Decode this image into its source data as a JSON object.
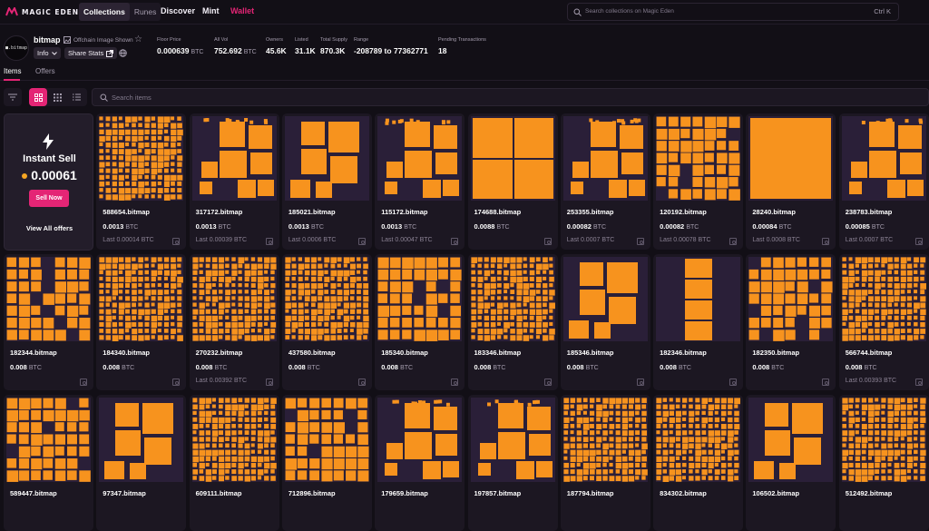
{
  "brand": {
    "name": "MAGIC EDEN",
    "accent": "#e42575"
  },
  "nav": {
    "tabs": [
      {
        "label": "Collections",
        "active": true
      },
      {
        "label": "Runes",
        "active": false
      }
    ],
    "links": [
      "Discover",
      "Mint",
      "Wallet"
    ],
    "wallet_color": "#e42575",
    "search_placeholder": "Search collections on Magic Eden",
    "search_shortcut": "Ctrl  K"
  },
  "collection": {
    "avatar_text": "■.bitmap",
    "name": "bitmap",
    "offchain_label": "Offchain Image Shown",
    "info_label": "Info",
    "share_label": "Share Stats",
    "stats": [
      {
        "label": "Floor Price",
        "value": "0.000639",
        "unit": "BTC"
      },
      {
        "label": "All Vol",
        "value": "752.692",
        "unit": "BTC"
      },
      {
        "label": "Owners",
        "value": "45.6K",
        "unit": ""
      },
      {
        "label": "Listed",
        "value": "31.1K",
        "unit": ""
      },
      {
        "label": "Total Supply",
        "value": "870.3K",
        "unit": ""
      },
      {
        "label": "Range",
        "value": "-208789 to 77362771",
        "unit": ""
      },
      {
        "label": "Pending Transactions",
        "value": "18",
        "unit": ""
      }
    ]
  },
  "subtabs": [
    {
      "label": "Items",
      "active": true
    },
    {
      "label": "Offers",
      "active": false
    }
  ],
  "search_items_placeholder": "Search items",
  "instant_sell": {
    "title": "Instant Sell",
    "price": "0.00061",
    "button": "Sell Now",
    "link": "View All offers"
  },
  "items": [
    {
      "name": "588654.bitmap",
      "price": "0.0013",
      "unit": "BTC",
      "last": "Last 0.00014 BTC",
      "pattern": "dense"
    },
    {
      "name": "317172.bitmap",
      "price": "0.0013",
      "unit": "BTC",
      "last": "Last 0.00039 BTC",
      "pattern": "blocks"
    },
    {
      "name": "185021.bitmap",
      "price": "0.0013",
      "unit": "BTC",
      "last": "Last 0.0006 BTC",
      "pattern": "few"
    },
    {
      "name": "115172.bitmap",
      "price": "0.0013",
      "unit": "BTC",
      "last": "Last 0.00047 BTC",
      "pattern": "blocks"
    },
    {
      "name": "174688.bitmap",
      "price": "0.0088",
      "unit": "BTC",
      "last": "",
      "pattern": "quad"
    },
    {
      "name": "253355.bitmap",
      "price": "0.00082",
      "unit": "BTC",
      "last": "Last 0.0007 BTC",
      "pattern": "blocks"
    },
    {
      "name": "120192.bitmap",
      "price": "0.00082",
      "unit": "BTC",
      "last": "Last 0.00078 BTC",
      "pattern": "grid"
    },
    {
      "name": "28240.bitmap",
      "price": "0.00084",
      "unit": "BTC",
      "last": "Last 0.0008 BTC",
      "pattern": "single"
    },
    {
      "name": "238783.bitmap",
      "price": "0.00085",
      "unit": "BTC",
      "last": "Last 0.0007 BTC",
      "pattern": "blocks"
    },
    {
      "name": "182344.bitmap",
      "price": "0.008",
      "unit": "BTC",
      "last": "",
      "pattern": "grid"
    },
    {
      "name": "184340.bitmap",
      "price": "0.008",
      "unit": "BTC",
      "last": "",
      "pattern": "dense"
    },
    {
      "name": "270232.bitmap",
      "price": "0.008",
      "unit": "BTC",
      "last": "Last 0.00392 BTC",
      "pattern": "dense"
    },
    {
      "name": "437580.bitmap",
      "price": "0.008",
      "unit": "BTC",
      "last": "",
      "pattern": "dense"
    },
    {
      "name": "185340.bitmap",
      "price": "0.008",
      "unit": "BTC",
      "last": "",
      "pattern": "grid"
    },
    {
      "name": "183346.bitmap",
      "price": "0.008",
      "unit": "BTC",
      "last": "",
      "pattern": "dense"
    },
    {
      "name": "185346.bitmap",
      "price": "0.008",
      "unit": "BTC",
      "last": "",
      "pattern": "few"
    },
    {
      "name": "182346.bitmap",
      "price": "0.008",
      "unit": "BTC",
      "last": "",
      "pattern": "column"
    },
    {
      "name": "182350.bitmap",
      "price": "0.008",
      "unit": "BTC",
      "last": "",
      "pattern": "grid"
    },
    {
      "name": "566744.bitmap",
      "price": "0.008",
      "unit": "BTC",
      "last": "Last 0.00393 BTC",
      "pattern": "dense"
    },
    {
      "name": "589447.bitmap",
      "price": "",
      "unit": "",
      "last": "",
      "pattern": "grid"
    },
    {
      "name": "97347.bitmap",
      "price": "",
      "unit": "",
      "last": "",
      "pattern": "few"
    },
    {
      "name": "609111.bitmap",
      "price": "",
      "unit": "",
      "last": "",
      "pattern": "dense"
    },
    {
      "name": "712896.bitmap",
      "price": "",
      "unit": "",
      "last": "",
      "pattern": "grid"
    },
    {
      "name": "179659.bitmap",
      "price": "",
      "unit": "",
      "last": "",
      "pattern": "blocks"
    },
    {
      "name": "197857.bitmap",
      "price": "",
      "unit": "",
      "last": "",
      "pattern": "blocks"
    },
    {
      "name": "187794.bitmap",
      "price": "",
      "unit": "",
      "last": "",
      "pattern": "dense"
    },
    {
      "name": "834302.bitmap",
      "price": "",
      "unit": "",
      "last": "",
      "pattern": "dense"
    },
    {
      "name": "106502.bitmap",
      "price": "",
      "unit": "",
      "last": "",
      "pattern": "few"
    },
    {
      "name": "512492.bitmap",
      "price": "",
      "unit": "",
      "last": "",
      "pattern": "dense"
    }
  ],
  "colors": {
    "background": "#120f16",
    "card": "#1c1722",
    "thumb_bg": "#2a1f38",
    "bitmap_orange": "#f7931e"
  }
}
